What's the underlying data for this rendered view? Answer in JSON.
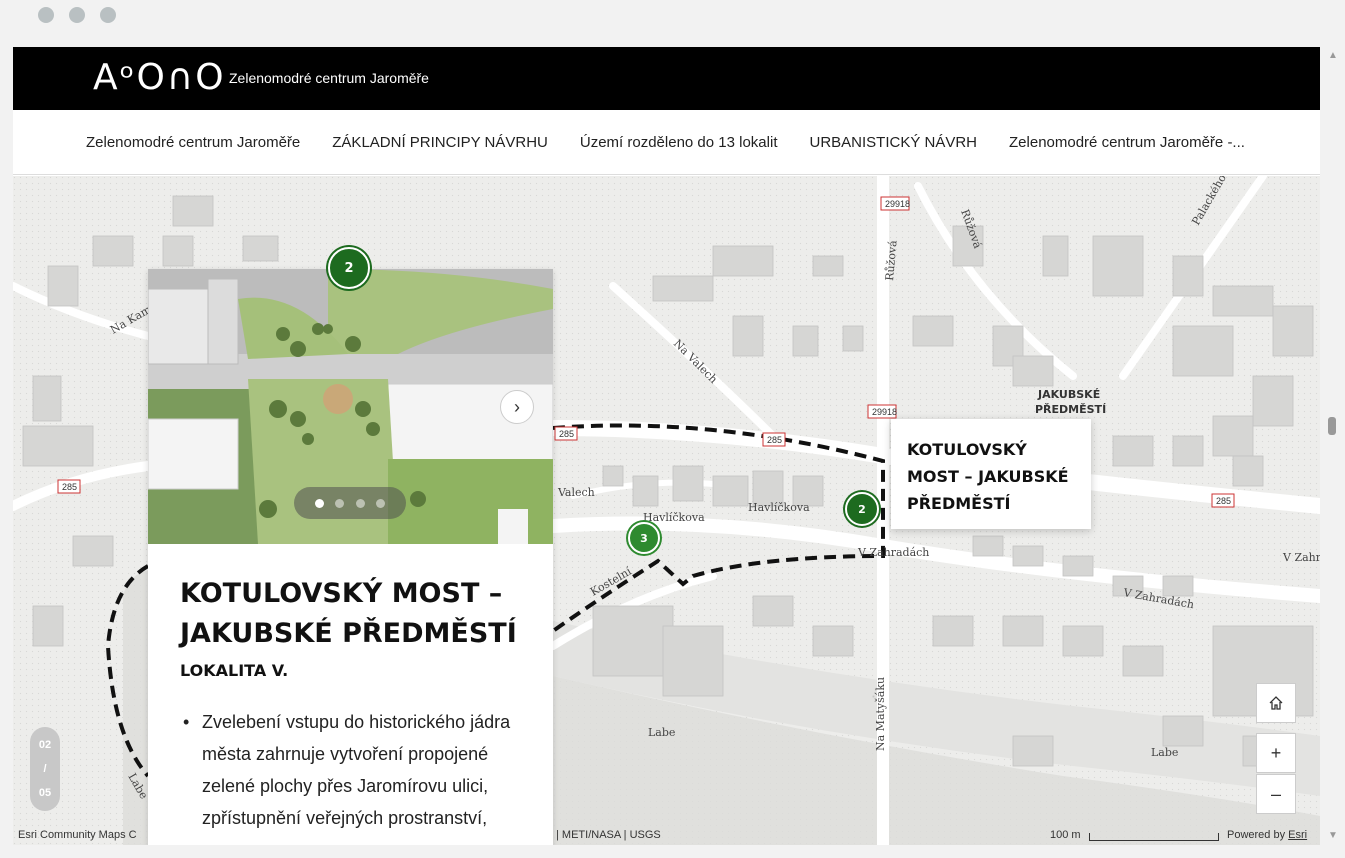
{
  "header": {
    "logo": "AᵒO∩O",
    "title": "Zelenomodré centrum Jaroměře"
  },
  "nav": {
    "items": [
      "Zelenomodré centrum Jaroměře",
      "ZÁKLADNÍ PRINCIPY NÁVRHU",
      "Území rozděleno do 13 lokalit",
      "URBANISTICKÝ NÁVRH",
      "Zelenomodré centrum Jaroměře -..."
    ]
  },
  "card": {
    "title": "KOTULOVSKÝ MOST – JAKUBSKÉ PŘEDMĚSTÍ",
    "subtitle": "LOKALITA V.",
    "bullet": "Zvelebení vstupu do historického jádra města zahrnuje vytvoření propojené zelené plochy přes Jaromírovu ulici, zpřístupnění veřejných prostranství,",
    "next_icon": "chevron-right-icon",
    "carousel": {
      "count": 4,
      "active": 0
    }
  },
  "clusters": {
    "top": "2",
    "left": "3",
    "right": "2"
  },
  "popup": {
    "title": "KOTULOVSKÝ MOST – JAKUBSKÉ PŘEDMĚSTÍ"
  },
  "slide_counter": {
    "current": "02",
    "sep": "/",
    "total": "05"
  },
  "map": {
    "labels": {
      "district": "JAKUBSKÉ PŘEDMĚSTÍ",
      "havlickova1": "Havlíčkova",
      "havlickova2": "Havlíčkova",
      "v_zahradach1": "V Zahradách",
      "v_zahradach2": "V Zahradách",
      "v_zahradach3": "V Zahr",
      "na_valech1": "Na Valech",
      "na_valech2": "Valech",
      "ruzova1": "Růžová",
      "ruzova2": "Růžová",
      "palackeho": "Palackého",
      "na_kam": "Na Kam",
      "kostelni": "Kostelní",
      "labe1": "Labe",
      "labe2": "Labe",
      "labe3": "Labe",
      "na_matysaku": "Na Matyšáku"
    },
    "road_shields": [
      "29918",
      "29918",
      "285",
      "285",
      "285",
      "285"
    ],
    "controls": {
      "home_icon": "home-icon",
      "zoom_in": "+",
      "zoom_out": "–"
    }
  },
  "attribution": {
    "left": "Esri Community Maps C",
    "middle": "| METI/NASA | USGS",
    "scale": "100 m",
    "powered_by": "Powered by",
    "powered_link": "Esri"
  },
  "colors": {
    "accent_green": "#1d6b1f",
    "header_bg": "#000000"
  }
}
